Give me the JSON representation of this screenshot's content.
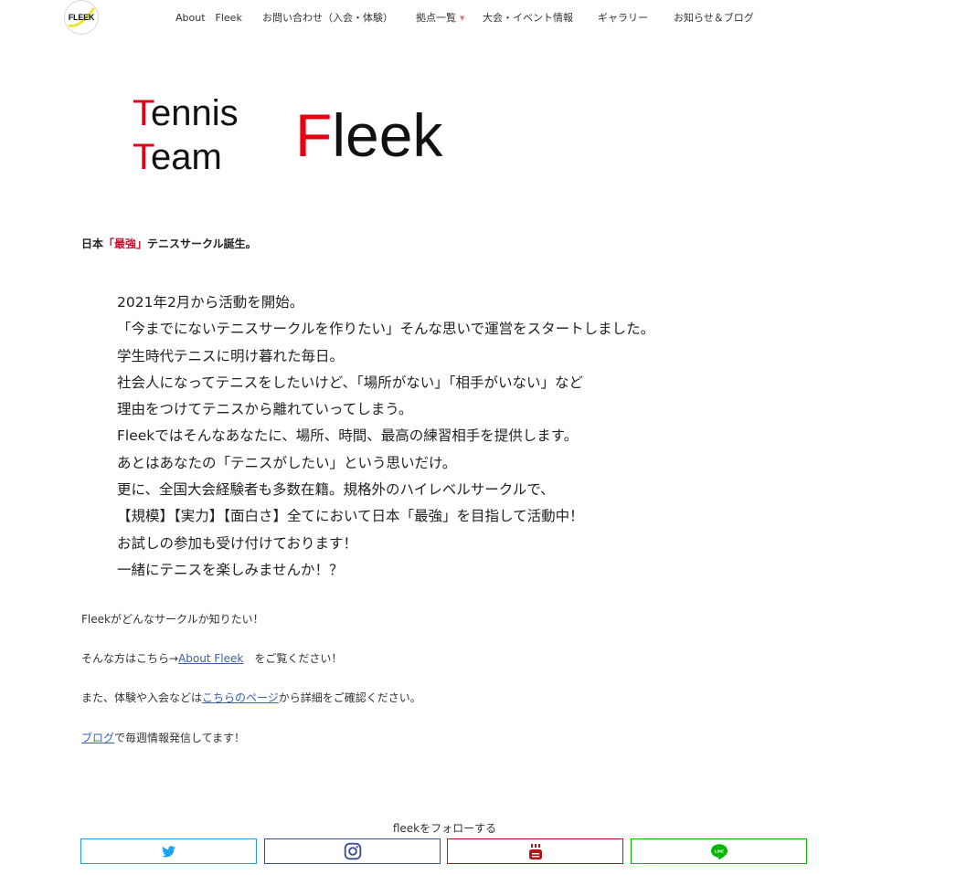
{
  "header": {
    "logo_text": "FLEEK",
    "nav": [
      {
        "label": "About　Fleek"
      },
      {
        "label": "お問い合わせ（入会・体験）"
      },
      {
        "label": "拠点一覧"
      },
      {
        "label": "大会・イベント情報"
      },
      {
        "label": "ギャラリー"
      },
      {
        "label": "お知らせ＆ブログ"
      }
    ]
  },
  "hero": {
    "line1_initial": "T",
    "line1_rest": "ennis",
    "line2_initial": "T",
    "line2_rest": "eam",
    "brand_initial": "F",
    "brand_rest": "leek"
  },
  "tagline": {
    "prefix": "日本",
    "highlight": "「最強」",
    "suffix": "テニスサークル誕生。"
  },
  "intro_lines": [
    "2021年2月から活動を開始。",
    "「今までにないテニスサークルを作りたい」そんな思いで運営をスタートしました。",
    "学生時代テニスに明け暮れた毎日。",
    "社会人になってテニスをしたいけど、「場所がない」「相手がいない」など",
    "理由をつけてテニスから離れていってしまう。",
    "Fleekではそんなあなたに、場所、時間、最高の練習相手を提供します。",
    "あとはあなたの「テニスがしたい」という思いだけ。",
    "更に、全国大会経験者も多数在籍。規格外のハイレベルサークルで、",
    "【規模】【実力】【面白さ】全てにおいて日本「最強」を目指して活動中！",
    "お試しの参加も受け付けております！",
    "一緒にテニスを楽しみませんか！？"
  ],
  "links_section": {
    "p1": "Fleekがどんなサークルか知りたい！",
    "p2_prefix": "そんな方はこちら→",
    "p2_link": "About Fleek",
    "p2_suffix": "　をご覧ください！",
    "p3_prefix": "また、体験や入会などは",
    "p3_link": "こちらのページ",
    "p3_suffix": "から詳細をご確認ください。",
    "p4_link": "ブログ",
    "p4_suffix": "で毎週情報発信してます！"
  },
  "follow": {
    "title": "fleekをフォローする",
    "buttons": [
      {
        "icon": "twitter-icon",
        "color": "#1da1f2"
      },
      {
        "icon": "instagram-icon",
        "color": "#3b4a9a"
      },
      {
        "icon": "youtube-icon",
        "color": "#b5141b"
      },
      {
        "icon": "line-icon",
        "color": "#00b900"
      }
    ]
  }
}
